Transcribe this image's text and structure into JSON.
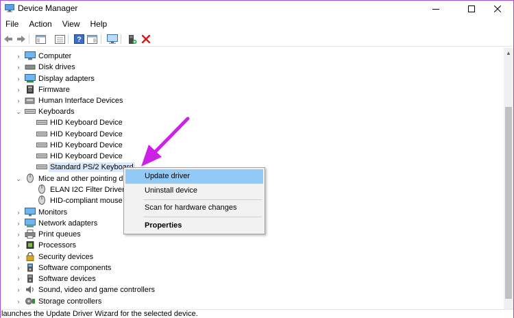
{
  "window": {
    "title": "Device Manager",
    "icon": "device-manager-icon"
  },
  "menu": [
    "File",
    "Action",
    "View",
    "Help"
  ],
  "toolbar": {
    "buttons": [
      "back-icon",
      "forward-icon",
      "properties-pane-icon",
      "show-hide-icon",
      "help-icon",
      "action-pane-icon",
      "monitor-icon",
      "add-driver-icon",
      "uninstall-icon"
    ]
  },
  "tree": {
    "categories": [
      {
        "label": "Computer",
        "icon": "computer-icon",
        "expanded": false
      },
      {
        "label": "Disk drives",
        "icon": "disk-drive-icon",
        "expanded": false
      },
      {
        "label": "Display adapters",
        "icon": "display-adapter-icon",
        "expanded": false
      },
      {
        "label": "Firmware",
        "icon": "firmware-icon",
        "expanded": false
      },
      {
        "label": "Human Interface Devices",
        "icon": "hid-icon",
        "expanded": false
      },
      {
        "label": "Keyboards",
        "icon": "keyboard-icon",
        "expanded": true,
        "children": [
          "HID Keyboard Device",
          "HID Keyboard Device",
          "HID Keyboard Device",
          "HID Keyboard Device",
          "Standard PS/2 Keyboard"
        ]
      },
      {
        "label": "Mice and other pointing d",
        "icon": "mouse-icon",
        "expanded": true,
        "children": [
          "ELAN I2C Filter Driver",
          "HID-compliant mouse"
        ]
      },
      {
        "label": "Monitors",
        "icon": "monitor-icon",
        "expanded": false
      },
      {
        "label": "Network adapters",
        "icon": "network-adapter-icon",
        "expanded": false
      },
      {
        "label": "Print queues",
        "icon": "printer-icon",
        "expanded": false
      },
      {
        "label": "Processors",
        "icon": "processor-icon",
        "expanded": false
      },
      {
        "label": "Security devices",
        "icon": "security-device-icon",
        "expanded": false
      },
      {
        "label": "Software components",
        "icon": "software-component-icon",
        "expanded": false
      },
      {
        "label": "Software devices",
        "icon": "software-device-icon",
        "expanded": false
      },
      {
        "label": "Sound, video and game controllers",
        "icon": "sound-icon",
        "expanded": false
      },
      {
        "label": "Storage controllers",
        "icon": "storage-controller-icon",
        "expanded": false
      }
    ],
    "selected": "Standard PS/2 Keyboard"
  },
  "context_menu": {
    "items": [
      "Update driver",
      "Uninstall device",
      "Scan for hardware changes",
      "Properties"
    ],
    "highlighted": "Update driver",
    "default": "Properties"
  },
  "status": "launches the Update Driver Wizard for the selected device.",
  "colors": {
    "accent_border": "#a64ad8",
    "annotation_arrow": "#cc22e6",
    "menu_highlight": "#91c9f7",
    "selection": "#d9e8fb"
  }
}
